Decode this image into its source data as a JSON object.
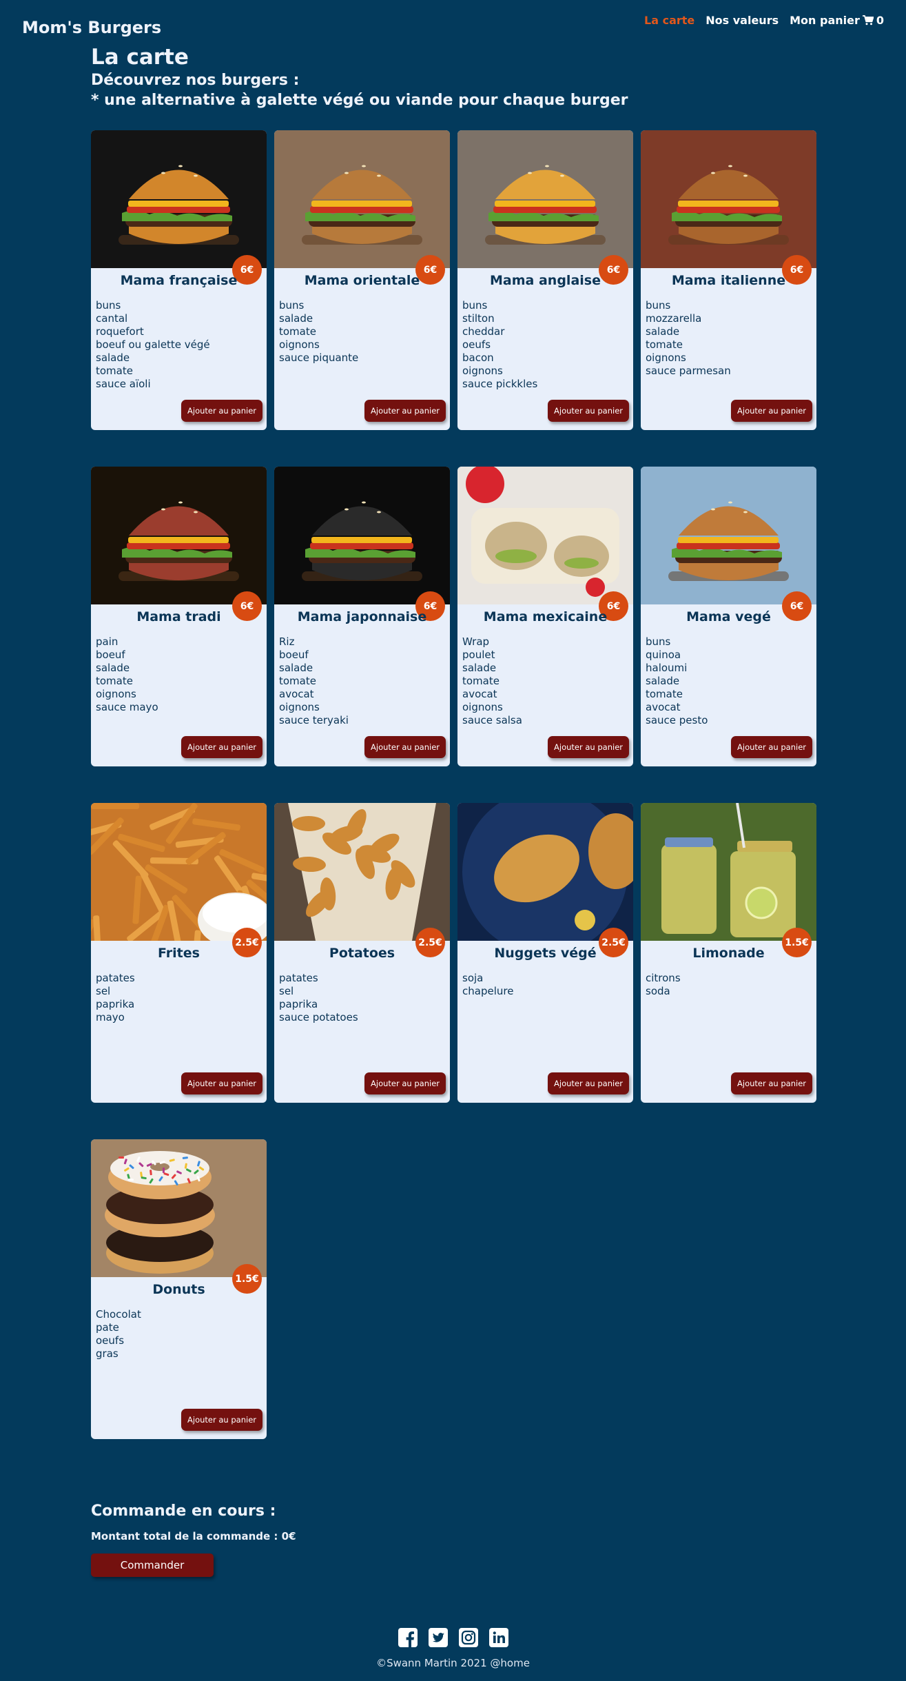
{
  "header": {
    "brand": "Mom's Burgers",
    "nav": [
      {
        "label": "La carte",
        "active": true
      },
      {
        "label": "Nos valeurs",
        "active": false
      },
      {
        "label": "Mon panier",
        "active": false
      }
    ],
    "cart_count": "0"
  },
  "intro": {
    "title": "La carte",
    "subtitle_1": "Découvrez nos burgers :",
    "subtitle_2": "* une alternative à galette végé ou viande pour chaque burger"
  },
  "products": [
    {
      "name": "Mama française",
      "price": "6€",
      "ingredients": [
        "buns",
        "cantal",
        "roquefort",
        "boeuf ou galette végé",
        "salade",
        "tomate",
        "sauce aïoli"
      ],
      "photo": "burger",
      "bg": "#141414",
      "bun": "#d2862b"
    },
    {
      "name": "Mama orientale",
      "price": "6€",
      "ingredients": [
        "buns",
        "salade",
        "tomate",
        "oignons",
        "sauce piquante"
      ],
      "photo": "burger",
      "bg": "#8b6f57",
      "bun": "#b77a3b"
    },
    {
      "name": "Mama anglaise",
      "price": "6€",
      "ingredients": [
        "buns",
        "stilton",
        "cheddar",
        "oeufs",
        "bacon",
        "oignons",
        "sauce pickkles"
      ],
      "photo": "burger",
      "bg": "#7d7268",
      "bun": "#e2a33a"
    },
    {
      "name": "Mama italienne",
      "price": "6€",
      "ingredients": [
        "buns",
        "mozzarella",
        "salade",
        "tomate",
        "oignons",
        "sauce parmesan"
      ],
      "photo": "burger",
      "bg": "#7e3b28",
      "bun": "#a9652d"
    },
    {
      "name": "Mama tradi",
      "price": "6€",
      "ingredients": [
        "pain",
        "boeuf",
        "salade",
        "tomate",
        "oignons",
        "sauce mayo"
      ],
      "photo": "burger",
      "bg": "#1a1208",
      "bun": "#9b3d2e"
    },
    {
      "name": "Mama japonnaise",
      "price": "6€",
      "ingredients": [
        "Riz",
        "boeuf",
        "salade",
        "tomate",
        "avocat",
        "oignons",
        "sauce teryaki"
      ],
      "photo": "burger",
      "bg": "#0c0c0c",
      "bun": "#2a2a2a"
    },
    {
      "name": "Mama mexicaine",
      "price": "6€",
      "ingredients": [
        "Wrap",
        "poulet",
        "salade",
        "tomate",
        "avocat",
        "oignons",
        "sauce salsa"
      ],
      "photo": "wrap",
      "bg": "#e9e5e0",
      "bun": "#f1ead9"
    },
    {
      "name": "Mama vegé",
      "price": "6€",
      "ingredients": [
        "buns",
        "quinoa",
        "haloumi",
        "salade",
        "tomate",
        "avocat",
        "sauce pesto"
      ],
      "photo": "burger",
      "bg": "#8fb2cf",
      "bun": "#c07b3a"
    },
    {
      "name": "Frites",
      "price": "2.5€",
      "ingredients": [
        "patates",
        "sel",
        "paprika",
        "mayo"
      ],
      "photo": "fries",
      "bg": "#c9782a",
      "bun": "#e59a3c"
    },
    {
      "name": "Potatoes",
      "price": "2.5€",
      "ingredients": [
        "patates",
        "sel",
        "paprika",
        "sauce potatoes"
      ],
      "photo": "potatoes",
      "bg": "#5a4a3c",
      "bun": "#cf8a36"
    },
    {
      "name": "Nuggets végé",
      "price": "2.5€",
      "ingredients": [
        "soja",
        "chapelure"
      ],
      "photo": "nuggets",
      "bg": "#0f2347",
      "bun": "#d49a45"
    },
    {
      "name": "Limonade",
      "price": "1.5€",
      "ingredients": [
        "citrons",
        "soda"
      ],
      "photo": "lemonade",
      "bg": "#4d6a2c",
      "bun": "#d9cf6a"
    },
    {
      "name": "Donuts",
      "price": "1.5€",
      "ingredients": [
        "Chocolat",
        "pate",
        "oeufs",
        "gras"
      ],
      "photo": "donuts",
      "bg": "#a38566",
      "bun": "#e0a765"
    }
  ],
  "add_button_label": "Ajouter au panier",
  "order": {
    "title": "Commande en cours :",
    "total": "Montant total de la commande : 0€",
    "button": "Commander"
  },
  "footer": {
    "socials": [
      "facebook-icon",
      "twitter-icon",
      "instagram-icon",
      "linkedin-icon"
    ],
    "copyright": "©Swann Martin 2021 @home"
  },
  "colors": {
    "background": "#033a5c",
    "accent": "#e2571b",
    "button": "#74110f",
    "card": "#e8effa"
  }
}
